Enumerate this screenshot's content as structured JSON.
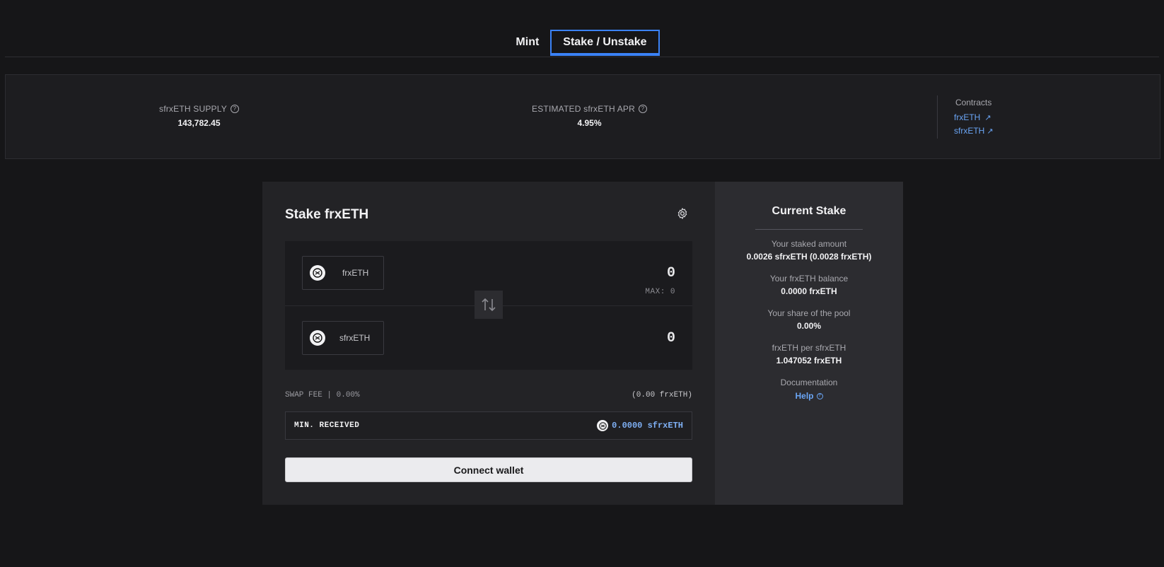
{
  "tabs": [
    {
      "label": "Mint",
      "active": false
    },
    {
      "label": "Stake / Unstake",
      "active": true
    }
  ],
  "stats": {
    "supply_label": "sfrxETH SUPPLY",
    "supply_value": "143,782.45",
    "apr_label": "ESTIMATED sfrxETH APR",
    "apr_value": "4.95%",
    "contracts_title": "Contracts",
    "contracts": [
      "frxETH",
      "sfrxETH"
    ]
  },
  "stake": {
    "title": "Stake frxETH",
    "from_token": "frxETH",
    "from_amount": "0",
    "max_label": "MAX: 0",
    "to_token": "sfrxETH",
    "to_amount": "0",
    "fee_label": "SWAP FEE | 0.00%",
    "fee_amount": "(0.00 frxETH)",
    "min_received_label": "MIN. RECEIVED",
    "min_received_value": "0.0000 sfrxETH",
    "connect_label": "Connect wallet"
  },
  "current_stake": {
    "title": "Current Stake",
    "items": [
      {
        "label": "Your staked amount",
        "value": "0.0026 sfrxETH (0.0028 frxETH)"
      },
      {
        "label": "Your frxETH balance",
        "value": "0.0000 frxETH"
      },
      {
        "label": "Your share of the pool",
        "value": "0.00%"
      },
      {
        "label": "frxETH per sfrxETH",
        "value": "1.047052 frxETH"
      }
    ],
    "docs_label": "Documentation",
    "docs_link": "Help"
  },
  "colors": {
    "accent": "#3b82f6",
    "link": "#6aa5f5",
    "background": "#161618"
  }
}
